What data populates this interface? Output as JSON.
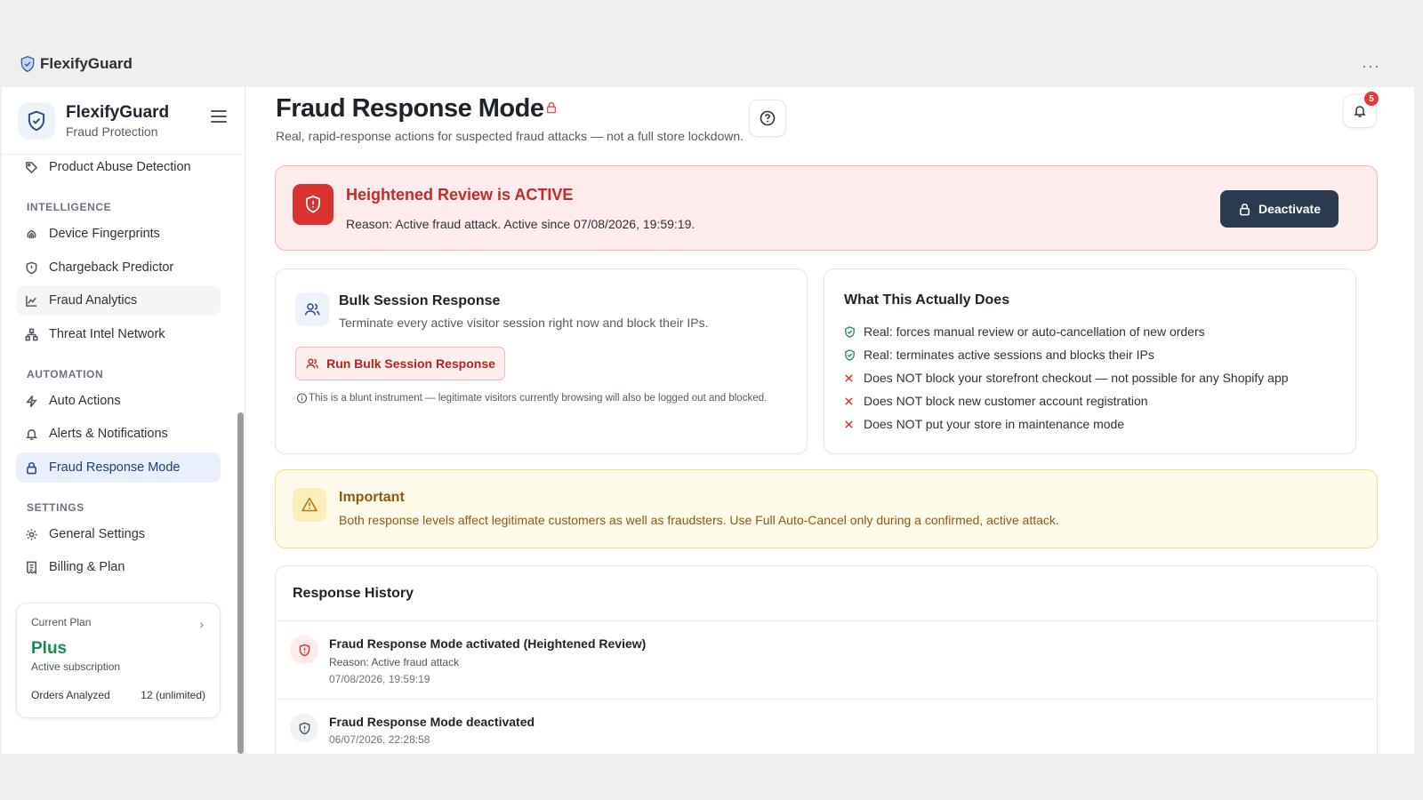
{
  "window": {
    "app_name": "FlexifyGuard",
    "more_label": "···"
  },
  "sidebar": {
    "title": "FlexifyGuard",
    "subtitle": "Fraud Protection",
    "items": [
      {
        "label": "Product Abuse Detection",
        "icon": "tag-icon"
      },
      {
        "label": "Device Fingerprints",
        "icon": "fingerprint-icon"
      },
      {
        "label": "Chargeback Predictor",
        "icon": "shield-icon"
      },
      {
        "label": "Fraud Analytics",
        "icon": "chart-line-icon"
      },
      {
        "label": "Threat Intel Network",
        "icon": "network-icon"
      },
      {
        "label": "Auto Actions",
        "icon": "bolt-icon"
      },
      {
        "label": "Alerts & Notifications",
        "icon": "bell-icon"
      },
      {
        "label": "Fraud Response Mode",
        "icon": "lock-icon"
      },
      {
        "label": "General Settings",
        "icon": "gear-icon"
      },
      {
        "label": "Billing & Plan",
        "icon": "receipt-icon"
      }
    ],
    "sections": {
      "intelligence": "INTELLIGENCE",
      "automation": "AUTOMATION",
      "settings": "SETTINGS"
    },
    "plan": {
      "label": "Current Plan",
      "name": "Plus",
      "status": "Active subscription",
      "orders_label": "Orders Analyzed",
      "orders_value": "12 (unlimited)"
    }
  },
  "header": {
    "title": "Fraud Response Mode",
    "subtitle": "Real, rapid-response actions for suspected fraud attacks — not a full store lockdown.",
    "notification_count": "5"
  },
  "active_banner": {
    "title": "Heightened Review is ACTIVE",
    "reason": "Reason: Active fraud attack. Active since 07/08/2026, 19:59:19.",
    "button": "Deactivate"
  },
  "bulk": {
    "title": "Bulk Session Response",
    "description": "Terminate every active visitor session right now and block their IPs.",
    "button": "Run Bulk Session Response",
    "note": "This is a blunt instrument — legitimate visitors currently browsing will also be logged out and blocked."
  },
  "what": {
    "title": "What This Actually Does",
    "items": [
      {
        "text": "Real: forces manual review or auto-cancellation of new orders",
        "kind": "check"
      },
      {
        "text": "Real: terminates active sessions and blocks their IPs",
        "kind": "check"
      },
      {
        "text": "Does NOT block your storefront checkout — not possible for any Shopify app",
        "kind": "cross"
      },
      {
        "text": "Does NOT block new customer account registration",
        "kind": "cross"
      },
      {
        "text": "Does NOT put your store in maintenance mode",
        "kind": "cross"
      }
    ]
  },
  "important": {
    "title": "Important",
    "text": "Both response levels affect legitimate customers as well as fraudsters. Use Full Auto-Cancel only during a confirmed, active attack."
  },
  "history": {
    "title": "Response History",
    "rows": [
      {
        "title": "Fraud Response Mode activated (Heightened Review)",
        "reason": "Reason: Active fraud attack",
        "date": "07/08/2026, 19:59:19"
      },
      {
        "title": "Fraud Response Mode deactivated",
        "reason": "",
        "date": "06/07/2026, 22:28:58"
      }
    ]
  },
  "colors": {
    "accent": "#2c4a86",
    "danger": "#d9322f",
    "warning_bg": "#fffbea",
    "success": "#1b8a4a"
  }
}
